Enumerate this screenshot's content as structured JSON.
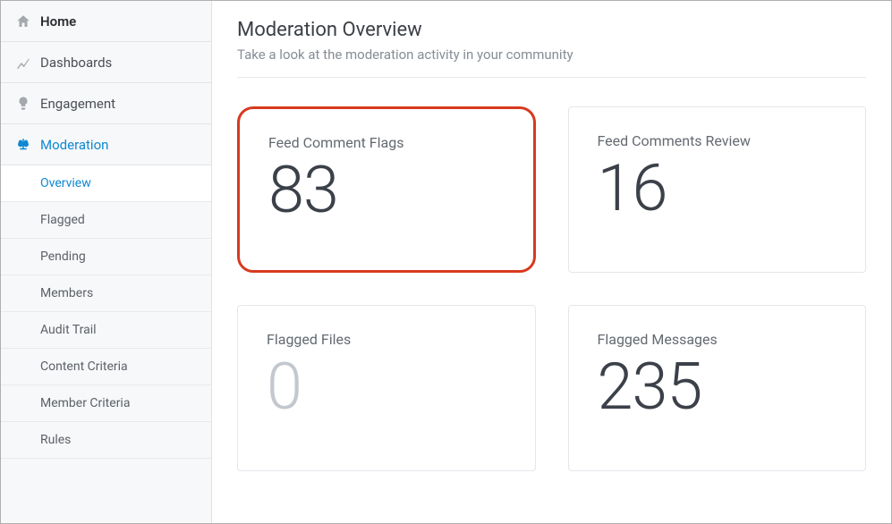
{
  "nav": {
    "items": [
      {
        "label": "Home",
        "icon": "home",
        "bold": true
      },
      {
        "label": "Dashboards",
        "icon": "chart"
      },
      {
        "label": "Engagement",
        "icon": "bulb"
      },
      {
        "label": "Moderation",
        "icon": "scale",
        "active": true
      }
    ],
    "sub": [
      {
        "label": "Overview",
        "active": true
      },
      {
        "label": "Flagged"
      },
      {
        "label": "Pending"
      },
      {
        "label": "Members"
      },
      {
        "label": "Audit Trail"
      },
      {
        "label": "Content Criteria"
      },
      {
        "label": "Member Criteria"
      },
      {
        "label": "Rules"
      }
    ]
  },
  "header": {
    "title": "Moderation Overview",
    "subtitle": "Take a look at the moderation activity in your community"
  },
  "cards": [
    {
      "label": "Feed Comment Flags",
      "value": "83",
      "highlight": true
    },
    {
      "label": "Feed Comments Review",
      "value": "16"
    },
    {
      "label": "Flagged Files",
      "value": "0",
      "fade": true
    },
    {
      "label": "Flagged Messages",
      "value": "235"
    }
  ]
}
